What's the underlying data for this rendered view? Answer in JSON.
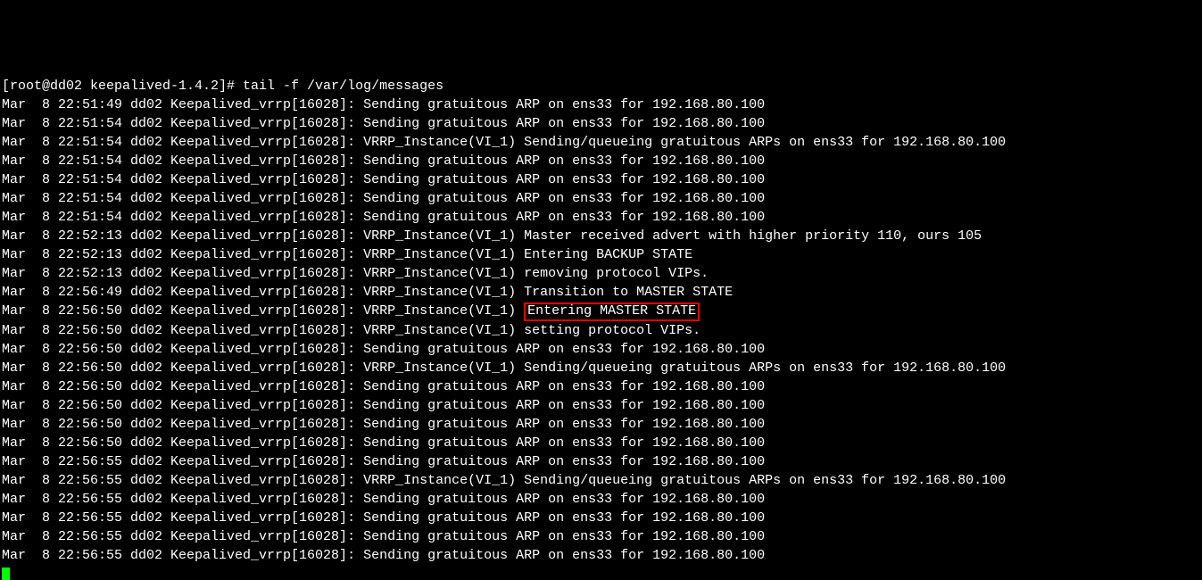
{
  "prompt": "[root@dd02 keepalived-1.4.2]# tail -f /var/log/messages",
  "highlighted": "Entering MASTER STATE",
  "lines": [
    "Mar  8 22:51:49 dd02 Keepalived_vrrp[16028]: Sending gratuitous ARP on ens33 for 192.168.80.100",
    "Mar  8 22:51:54 dd02 Keepalived_vrrp[16028]: Sending gratuitous ARP on ens33 for 192.168.80.100",
    "Mar  8 22:51:54 dd02 Keepalived_vrrp[16028]: VRRP_Instance(VI_1) Sending/queueing gratuitous ARPs on ens33 for 192.168.80.100",
    "Mar  8 22:51:54 dd02 Keepalived_vrrp[16028]: Sending gratuitous ARP on ens33 for 192.168.80.100",
    "Mar  8 22:51:54 dd02 Keepalived_vrrp[16028]: Sending gratuitous ARP on ens33 for 192.168.80.100",
    "Mar  8 22:51:54 dd02 Keepalived_vrrp[16028]: Sending gratuitous ARP on ens33 for 192.168.80.100",
    "Mar  8 22:51:54 dd02 Keepalived_vrrp[16028]: Sending gratuitous ARP on ens33 for 192.168.80.100",
    "Mar  8 22:52:13 dd02 Keepalived_vrrp[16028]: VRRP_Instance(VI_1) Master received advert with higher priority 110, ours 105",
    "Mar  8 22:52:13 dd02 Keepalived_vrrp[16028]: VRRP_Instance(VI_1) Entering BACKUP STATE",
    "Mar  8 22:52:13 dd02 Keepalived_vrrp[16028]: VRRP_Instance(VI_1) removing protocol VIPs.",
    "Mar  8 22:56:49 dd02 Keepalived_vrrp[16028]: VRRP_Instance(VI_1) Transition to MASTER STATE"
  ],
  "hl_prefix": "Mar  8 22:56:50 dd02 Keepalived_vrrp[16028]: VRRP_Instance(VI_1) ",
  "lines2": [
    "Mar  8 22:56:50 dd02 Keepalived_vrrp[16028]: VRRP_Instance(VI_1) setting protocol VIPs.",
    "Mar  8 22:56:50 dd02 Keepalived_vrrp[16028]: Sending gratuitous ARP on ens33 for 192.168.80.100",
    "Mar  8 22:56:50 dd02 Keepalived_vrrp[16028]: VRRP_Instance(VI_1) Sending/queueing gratuitous ARPs on ens33 for 192.168.80.100",
    "Mar  8 22:56:50 dd02 Keepalived_vrrp[16028]: Sending gratuitous ARP on ens33 for 192.168.80.100",
    "Mar  8 22:56:50 dd02 Keepalived_vrrp[16028]: Sending gratuitous ARP on ens33 for 192.168.80.100",
    "Mar  8 22:56:50 dd02 Keepalived_vrrp[16028]: Sending gratuitous ARP on ens33 for 192.168.80.100",
    "Mar  8 22:56:50 dd02 Keepalived_vrrp[16028]: Sending gratuitous ARP on ens33 for 192.168.80.100",
    "Mar  8 22:56:55 dd02 Keepalived_vrrp[16028]: Sending gratuitous ARP on ens33 for 192.168.80.100",
    "Mar  8 22:56:55 dd02 Keepalived_vrrp[16028]: VRRP_Instance(VI_1) Sending/queueing gratuitous ARPs on ens33 for 192.168.80.100",
    "Mar  8 22:56:55 dd02 Keepalived_vrrp[16028]: Sending gratuitous ARP on ens33 for 192.168.80.100",
    "Mar  8 22:56:55 dd02 Keepalived_vrrp[16028]: Sending gratuitous ARP on ens33 for 192.168.80.100",
    "Mar  8 22:56:55 dd02 Keepalived_vrrp[16028]: Sending gratuitous ARP on ens33 for 192.168.80.100",
    "Mar  8 22:56:55 dd02 Keepalived_vrrp[16028]: Sending gratuitous ARP on ens33 for 192.168.80.100"
  ]
}
